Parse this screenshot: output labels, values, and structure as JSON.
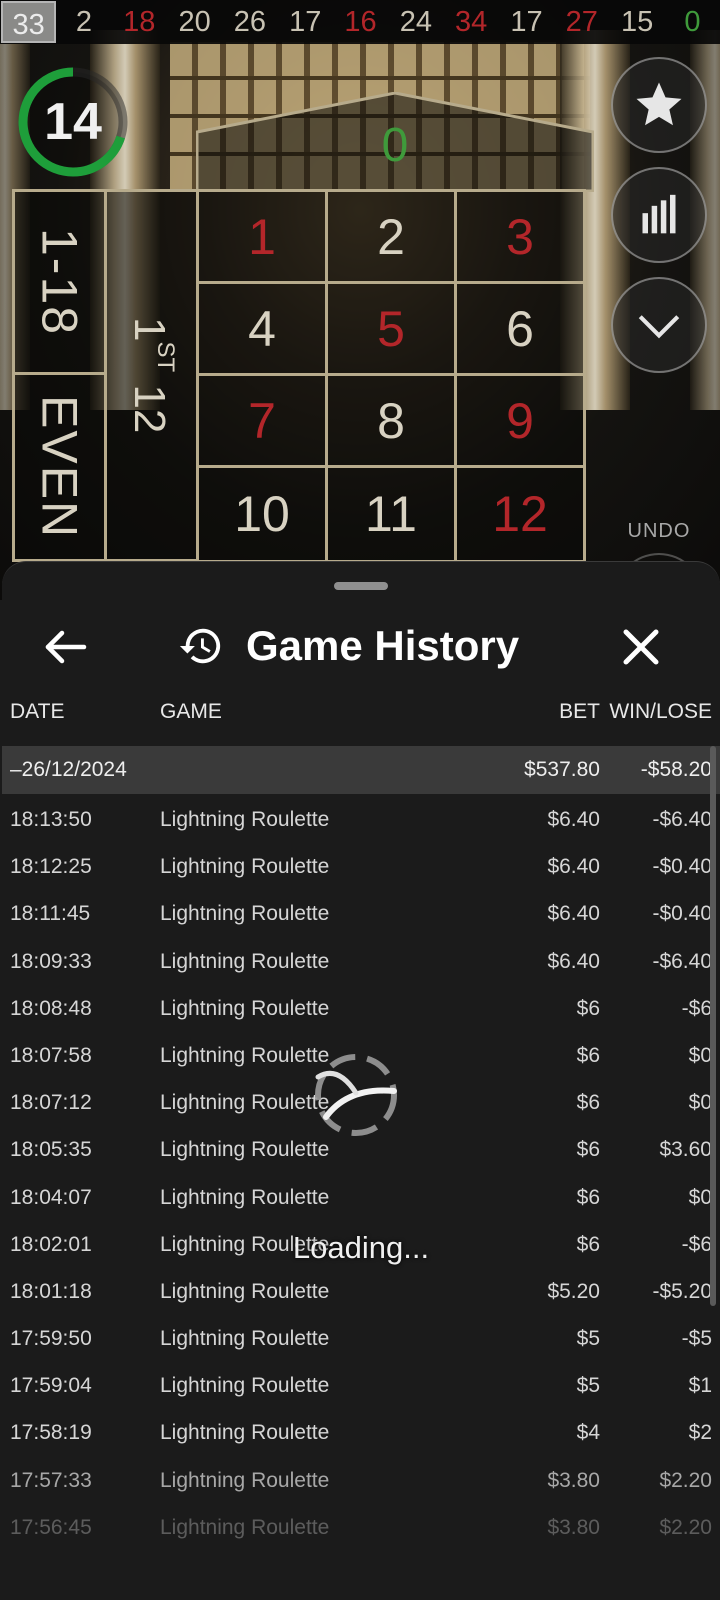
{
  "result_history": [
    {
      "value": "33",
      "color": "latest"
    },
    {
      "value": "2",
      "color": "black"
    },
    {
      "value": "18",
      "color": "red"
    },
    {
      "value": "20",
      "color": "black"
    },
    {
      "value": "26",
      "color": "black"
    },
    {
      "value": "17",
      "color": "black"
    },
    {
      "value": "16",
      "color": "red"
    },
    {
      "value": "24",
      "color": "black"
    },
    {
      "value": "34",
      "color": "red"
    },
    {
      "value": "17",
      "color": "black"
    },
    {
      "value": "27",
      "color": "red"
    },
    {
      "value": "15",
      "color": "black"
    },
    {
      "value": "0",
      "color": "green"
    }
  ],
  "timer": {
    "value": "14",
    "progress": 0.7
  },
  "side_buttons": {
    "favorite_icon": "star-icon",
    "stats_icon": "statistics-icon",
    "collapse_icon": "chevron-down-icon",
    "undo_label": "UNDO"
  },
  "table": {
    "zero": "0",
    "low_label": "1-18",
    "even_label": "EVEN",
    "dozen_main": "1",
    "dozen_sup": "ST",
    "dozen_rest": " 12",
    "numbers": [
      {
        "n": "1",
        "red": true
      },
      {
        "n": "2",
        "red": false
      },
      {
        "n": "3",
        "red": true
      },
      {
        "n": "4",
        "red": false
      },
      {
        "n": "5",
        "red": true
      },
      {
        "n": "6",
        "red": false
      },
      {
        "n": "7",
        "red": true
      },
      {
        "n": "8",
        "red": false
      },
      {
        "n": "9",
        "red": true
      },
      {
        "n": "10",
        "red": false
      },
      {
        "n": "11",
        "red": false
      },
      {
        "n": "12",
        "red": true
      }
    ]
  },
  "sheet": {
    "title": "Game History",
    "columns": {
      "date": "DATE",
      "game": "GAME",
      "bet": "BET",
      "win_lose": "WIN/LOSE"
    },
    "day": {
      "date": "–26/12/2024",
      "bet": "$537.80",
      "win_lose": "-$58.20"
    },
    "rows": [
      {
        "time": "18:13:50",
        "game": "Lightning Roulette",
        "bet": "$6.40",
        "win_lose": "-$6.40"
      },
      {
        "time": "18:12:25",
        "game": "Lightning Roulette",
        "bet": "$6.40",
        "win_lose": "-$0.40"
      },
      {
        "time": "18:11:45",
        "game": "Lightning Roulette",
        "bet": "$6.40",
        "win_lose": "-$0.40"
      },
      {
        "time": "18:09:33",
        "game": "Lightning Roulette",
        "bet": "$6.40",
        "win_lose": "-$6.40"
      },
      {
        "time": "18:08:48",
        "game": "Lightning Roulette",
        "bet": "$6",
        "win_lose": "-$6"
      },
      {
        "time": "18:07:58",
        "game": "Lightning Roulette",
        "bet": "$6",
        "win_lose": "$0"
      },
      {
        "time": "18:07:12",
        "game": "Lightning Roulette",
        "bet": "$6",
        "win_lose": "$0"
      },
      {
        "time": "18:05:35",
        "game": "Lightning Roulette",
        "bet": "$6",
        "win_lose": "$3.60"
      },
      {
        "time": "18:04:07",
        "game": "Lightning Roulette",
        "bet": "$6",
        "win_lose": "$0"
      },
      {
        "time": "18:02:01",
        "game": "Lightning Roulette",
        "bet": "$6",
        "win_lose": "-$6"
      },
      {
        "time": "18:01:18",
        "game": "Lightning Roulette",
        "bet": "$5.20",
        "win_lose": "-$5.20"
      },
      {
        "time": "17:59:50",
        "game": "Lightning Roulette",
        "bet": "$5",
        "win_lose": "-$5"
      },
      {
        "time": "17:59:04",
        "game": "Lightning Roulette",
        "bet": "$5",
        "win_lose": "$1"
      },
      {
        "time": "17:58:19",
        "game": "Lightning Roulette",
        "bet": "$4",
        "win_lose": "$2"
      },
      {
        "time": "17:57:33",
        "game": "Lightning Roulette",
        "bet": "$3.80",
        "win_lose": "$2.20"
      },
      {
        "time": "17:56:45",
        "game": "Lightning Roulette",
        "bet": "$3.80",
        "win_lose": "$2.20"
      }
    ],
    "loading_text": "Loading..."
  },
  "colors": {
    "red": "#b3262a",
    "green": "#3f9a3b",
    "timer_ring": "#1e9e3a",
    "sheet_bg": "#1b1b1b",
    "day_row_bg": "#3a3a3a"
  }
}
